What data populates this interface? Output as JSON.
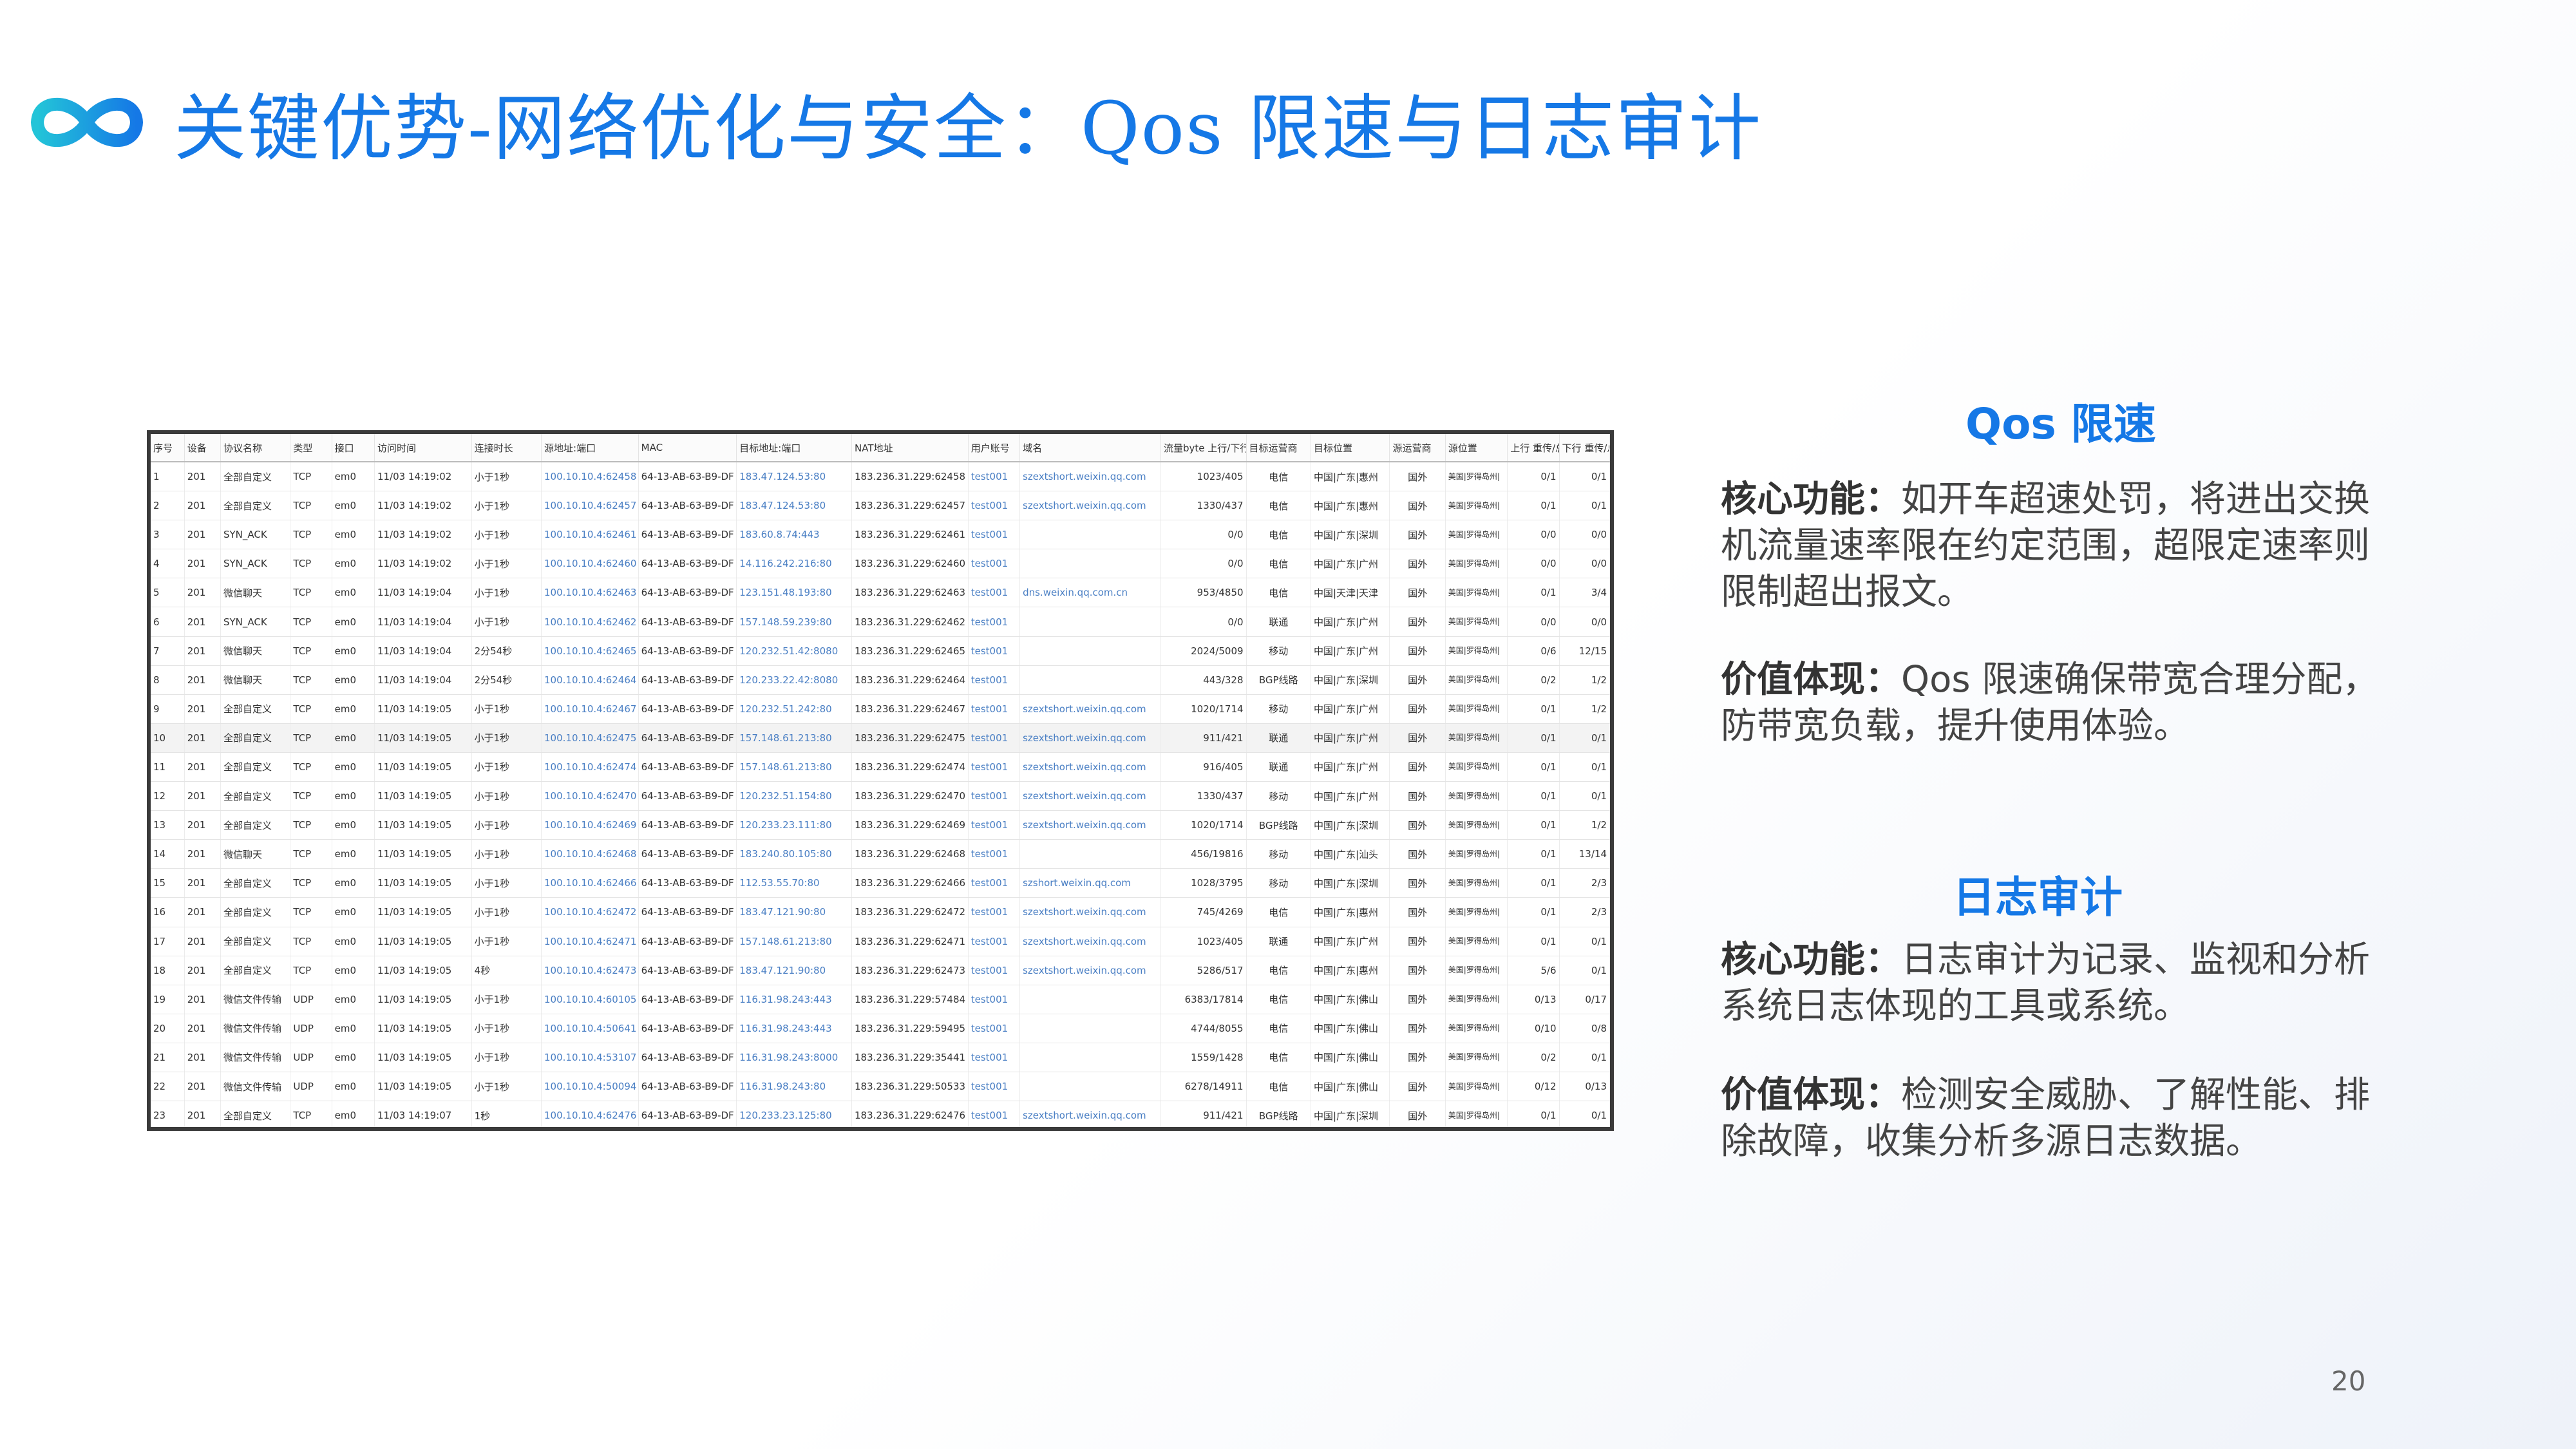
{
  "title": "关键优势-网络优化与安全：Qos 限速与日志审计",
  "colors": {
    "accent": "#1578e6",
    "link": "#4a7fc4",
    "frame": "#3a3a3a"
  },
  "icon": "infinity-icon",
  "table": {
    "headers": [
      "序号",
      "设备",
      "协议名称",
      "类型",
      "接口",
      "访问时间",
      "连接时长",
      "源地址:端口",
      "MAC",
      "目标地址:端口",
      "NAT地址",
      "用户账号",
      "域名",
      "流量byte 上行/下行",
      "目标运营商",
      "目标位置",
      "源运营商",
      "源位置",
      "上行 重传/总包数",
      "下行 重传/总包数"
    ],
    "rows": [
      [
        "1",
        "201",
        "全部自定义",
        "TCP",
        "em0",
        "11/03 14:19:02",
        "小于1秒",
        "100.10.10.4:62458",
        "64-13-AB-63-B9-DF",
        "183.47.124.53:80",
        "183.236.31.229:62458",
        "test001",
        "szextshort.weixin.qq.com",
        "1023/405",
        "电信",
        "中国|广东|惠州",
        "国外",
        "美国|罗得岛州|",
        "0/1",
        "0/1"
      ],
      [
        "2",
        "201",
        "全部自定义",
        "TCP",
        "em0",
        "11/03 14:19:02",
        "小于1秒",
        "100.10.10.4:62457",
        "64-13-AB-63-B9-DF",
        "183.47.124.53:80",
        "183.236.31.229:62457",
        "test001",
        "szextshort.weixin.qq.com",
        "1330/437",
        "电信",
        "中国|广东|惠州",
        "国外",
        "美国|罗得岛州|",
        "0/1",
        "0/1"
      ],
      [
        "3",
        "201",
        "SYN_ACK",
        "TCP",
        "em0",
        "11/03 14:19:02",
        "小于1秒",
        "100.10.10.4:62461",
        "64-13-AB-63-B9-DF",
        "183.60.8.74:443",
        "183.236.31.229:62461",
        "test001",
        "",
        "0/0",
        "电信",
        "中国|广东|深圳",
        "国外",
        "美国|罗得岛州|",
        "0/0",
        "0/0"
      ],
      [
        "4",
        "201",
        "SYN_ACK",
        "TCP",
        "em0",
        "11/03 14:19:02",
        "小于1秒",
        "100.10.10.4:62460",
        "64-13-AB-63-B9-DF",
        "14.116.242.216:80",
        "183.236.31.229:62460",
        "test001",
        "",
        "0/0",
        "电信",
        "中国|广东|广州",
        "国外",
        "美国|罗得岛州|",
        "0/0",
        "0/0"
      ],
      [
        "5",
        "201",
        "微信聊天",
        "TCP",
        "em0",
        "11/03 14:19:04",
        "小于1秒",
        "100.10.10.4:62463",
        "64-13-AB-63-B9-DF",
        "123.151.48.193:80",
        "183.236.31.229:62463",
        "test001",
        "dns.weixin.qq.com.cn",
        "953/4850",
        "电信",
        "中国|天津|天津",
        "国外",
        "美国|罗得岛州|",
        "0/1",
        "3/4"
      ],
      [
        "6",
        "201",
        "SYN_ACK",
        "TCP",
        "em0",
        "11/03 14:19:04",
        "小于1秒",
        "100.10.10.4:62462",
        "64-13-AB-63-B9-DF",
        "157.148.59.239:80",
        "183.236.31.229:62462",
        "test001",
        "",
        "0/0",
        "联通",
        "中国|广东|广州",
        "国外",
        "美国|罗得岛州|",
        "0/0",
        "0/0"
      ],
      [
        "7",
        "201",
        "微信聊天",
        "TCP",
        "em0",
        "11/03 14:19:04",
        "2分54秒",
        "100.10.10.4:62465",
        "64-13-AB-63-B9-DF",
        "120.232.51.42:8080",
        "183.236.31.229:62465",
        "test001",
        "",
        "2024/5009",
        "移动",
        "中国|广东|广州",
        "国外",
        "美国|罗得岛州|",
        "0/6",
        "12/15"
      ],
      [
        "8",
        "201",
        "微信聊天",
        "TCP",
        "em0",
        "11/03 14:19:04",
        "2分54秒",
        "100.10.10.4:62464",
        "64-13-AB-63-B9-DF",
        "120.233.22.42:8080",
        "183.236.31.229:62464",
        "test001",
        "",
        "443/328",
        "BGP线路",
        "中国|广东|深圳",
        "国外",
        "美国|罗得岛州|",
        "0/2",
        "1/2"
      ],
      [
        "9",
        "201",
        "全部自定义",
        "TCP",
        "em0",
        "11/03 14:19:05",
        "小于1秒",
        "100.10.10.4:62467",
        "64-13-AB-63-B9-DF",
        "120.232.51.242:80",
        "183.236.31.229:62467",
        "test001",
        "szextshort.weixin.qq.com",
        "1020/1714",
        "移动",
        "中国|广东|广州",
        "国外",
        "美国|罗得岛州|",
        "0/1",
        "1/2"
      ],
      [
        "10",
        "201",
        "全部自定义",
        "TCP",
        "em0",
        "11/03 14:19:05",
        "小于1秒",
        "100.10.10.4:62475",
        "64-13-AB-63-B9-DF",
        "157.148.61.213:80",
        "183.236.31.229:62475",
        "test001",
        "szextshort.weixin.qq.com",
        "911/421",
        "联通",
        "中国|广东|广州",
        "国外",
        "美国|罗得岛州|",
        "0/1",
        "0/1"
      ],
      [
        "11",
        "201",
        "全部自定义",
        "TCP",
        "em0",
        "11/03 14:19:05",
        "小于1秒",
        "100.10.10.4:62474",
        "64-13-AB-63-B9-DF",
        "157.148.61.213:80",
        "183.236.31.229:62474",
        "test001",
        "szextshort.weixin.qq.com",
        "916/405",
        "联通",
        "中国|广东|广州",
        "国外",
        "美国|罗得岛州|",
        "0/1",
        "0/1"
      ],
      [
        "12",
        "201",
        "全部自定义",
        "TCP",
        "em0",
        "11/03 14:19:05",
        "小于1秒",
        "100.10.10.4:62470",
        "64-13-AB-63-B9-DF",
        "120.232.51.154:80",
        "183.236.31.229:62470",
        "test001",
        "szextshort.weixin.qq.com",
        "1330/437",
        "移动",
        "中国|广东|广州",
        "国外",
        "美国|罗得岛州|",
        "0/1",
        "0/1"
      ],
      [
        "13",
        "201",
        "全部自定义",
        "TCP",
        "em0",
        "11/03 14:19:05",
        "小于1秒",
        "100.10.10.4:62469",
        "64-13-AB-63-B9-DF",
        "120.233.23.111:80",
        "183.236.31.229:62469",
        "test001",
        "szextshort.weixin.qq.com",
        "1020/1714",
        "BGP线路",
        "中国|广东|深圳",
        "国外",
        "美国|罗得岛州|",
        "0/1",
        "1/2"
      ],
      [
        "14",
        "201",
        "微信聊天",
        "TCP",
        "em0",
        "11/03 14:19:05",
        "小于1秒",
        "100.10.10.4:62468",
        "64-13-AB-63-B9-DF",
        "183.240.80.105:80",
        "183.236.31.229:62468",
        "test001",
        "",
        "456/19816",
        "移动",
        "中国|广东|汕头",
        "国外",
        "美国|罗得岛州|",
        "0/1",
        "13/14"
      ],
      [
        "15",
        "201",
        "全部自定义",
        "TCP",
        "em0",
        "11/03 14:19:05",
        "小于1秒",
        "100.10.10.4:62466",
        "64-13-AB-63-B9-DF",
        "112.53.55.70:80",
        "183.236.31.229:62466",
        "test001",
        "szshort.weixin.qq.com",
        "1028/3795",
        "移动",
        "中国|广东|深圳",
        "国外",
        "美国|罗得岛州|",
        "0/1",
        "2/3"
      ],
      [
        "16",
        "201",
        "全部自定义",
        "TCP",
        "em0",
        "11/03 14:19:05",
        "小于1秒",
        "100.10.10.4:62472",
        "64-13-AB-63-B9-DF",
        "183.47.121.90:80",
        "183.236.31.229:62472",
        "test001",
        "szextshort.weixin.qq.com",
        "745/4269",
        "电信",
        "中国|广东|惠州",
        "国外",
        "美国|罗得岛州|",
        "0/1",
        "2/3"
      ],
      [
        "17",
        "201",
        "全部自定义",
        "TCP",
        "em0",
        "11/03 14:19:05",
        "小于1秒",
        "100.10.10.4:62471",
        "64-13-AB-63-B9-DF",
        "157.148.61.213:80",
        "183.236.31.229:62471",
        "test001",
        "szextshort.weixin.qq.com",
        "1023/405",
        "联通",
        "中国|广东|广州",
        "国外",
        "美国|罗得岛州|",
        "0/1",
        "0/1"
      ],
      [
        "18",
        "201",
        "全部自定义",
        "TCP",
        "em0",
        "11/03 14:19:05",
        "4秒",
        "100.10.10.4:62473",
        "64-13-AB-63-B9-DF",
        "183.47.121.90:80",
        "183.236.31.229:62473",
        "test001",
        "szextshort.weixin.qq.com",
        "5286/517",
        "电信",
        "中国|广东|惠州",
        "国外",
        "美国|罗得岛州|",
        "5/6",
        "0/1"
      ],
      [
        "19",
        "201",
        "微信文件传输",
        "UDP",
        "em0",
        "11/03 14:19:05",
        "小于1秒",
        "100.10.10.4:60105",
        "64-13-AB-63-B9-DF",
        "116.31.98.243:443",
        "183.236.31.229:57484",
        "test001",
        "",
        "6383/17814",
        "电信",
        "中国|广东|佛山",
        "国外",
        "美国|罗得岛州|",
        "0/13",
        "0/17"
      ],
      [
        "20",
        "201",
        "微信文件传输",
        "UDP",
        "em0",
        "11/03 14:19:05",
        "小于1秒",
        "100.10.10.4:50641",
        "64-13-AB-63-B9-DF",
        "116.31.98.243:443",
        "183.236.31.229:59495",
        "test001",
        "",
        "4744/8055",
        "电信",
        "中国|广东|佛山",
        "国外",
        "美国|罗得岛州|",
        "0/10",
        "0/8"
      ],
      [
        "21",
        "201",
        "微信文件传输",
        "UDP",
        "em0",
        "11/03 14:19:05",
        "小于1秒",
        "100.10.10.4:53107",
        "64-13-AB-63-B9-DF",
        "116.31.98.243:8000",
        "183.236.31.229:35441",
        "test001",
        "",
        "1559/1428",
        "电信",
        "中国|广东|佛山",
        "国外",
        "美国|罗得岛州|",
        "0/2",
        "0/1"
      ],
      [
        "22",
        "201",
        "微信文件传输",
        "UDP",
        "em0",
        "11/03 14:19:05",
        "小于1秒",
        "100.10.10.4:50094",
        "64-13-AB-63-B9-DF",
        "116.31.98.243:80",
        "183.236.31.229:50533",
        "test001",
        "",
        "6278/14911",
        "电信",
        "中国|广东|佛山",
        "国外",
        "美国|罗得岛州|",
        "0/12",
        "0/13"
      ],
      [
        "23",
        "201",
        "全部自定义",
        "TCP",
        "em0",
        "11/03 14:19:07",
        "1秒",
        "100.10.10.4:62476",
        "64-13-AB-63-B9-DF",
        "120.233.23.125:80",
        "183.236.31.229:62476",
        "test001",
        "szextshort.weixin.qq.com",
        "911/421",
        "BGP线路",
        "中国|广东|深圳",
        "国外",
        "美国|罗得岛州|",
        "0/1",
        "0/1"
      ]
    ]
  },
  "qos": {
    "title": "Qos 限速",
    "core_label": "核心功能：",
    "core_text": "如开车超速处罚，将进出交换机流量速率限在约定范围，超限定速率则限制超出报文。",
    "value_label": "价值体现：",
    "value_text": "Qos 限速确保带宽合理分配，防带宽负载，提升使用体验。"
  },
  "audit": {
    "title": "日志审计",
    "core_label": "核心功能：",
    "core_text": "日志审计为记录、监视和分析系统日志体现的工具或系统。",
    "value_label": "价值体现：",
    "value_text": "检测安全威胁、了解性能、排除故障，收集分析多源日志数据。"
  },
  "page_number": "20"
}
